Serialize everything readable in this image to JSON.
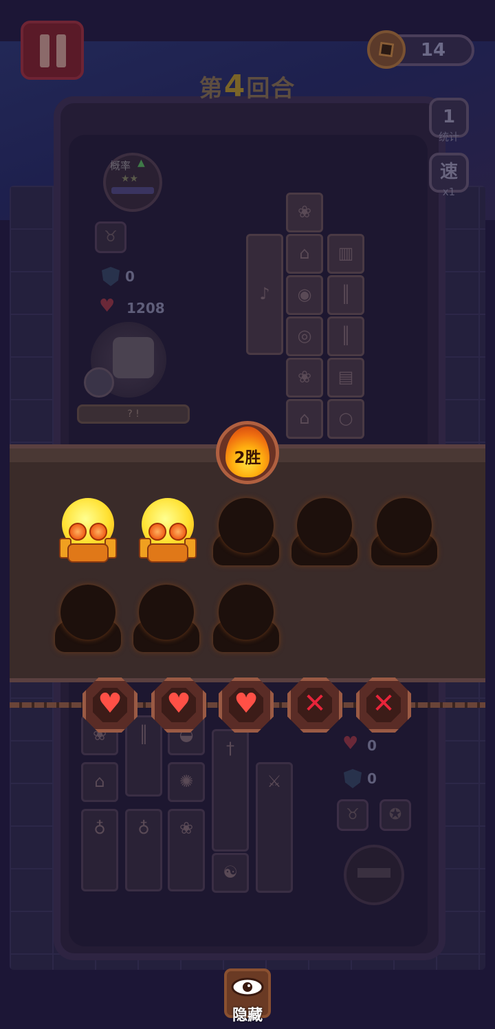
{
  "header": {
    "coin_count": "14",
    "round_prefix": "第",
    "round_number": "4",
    "round_suffix": "回合"
  },
  "side_buttons": [
    {
      "icon": "1",
      "label": "统计"
    },
    {
      "icon": "速",
      "label": "x1"
    }
  ],
  "opponent": {
    "probability_label": "概率",
    "shield": "0",
    "health": "1208",
    "name_plate": "? !"
  },
  "result_panel": {
    "wins_label": "2胜",
    "slots_filled": 2,
    "slots_total": 8
  },
  "lives": [
    {
      "state": "heart"
    },
    {
      "state": "heart"
    },
    {
      "state": "heart"
    },
    {
      "state": "lost"
    },
    {
      "state": "lost"
    }
  ],
  "player": {
    "health": "0",
    "shield": "0"
  },
  "hide_button": {
    "label": "隐藏"
  },
  "colors": {
    "heart": "#ff5046",
    "lost": "#e8243a",
    "flame": "#ffb010",
    "panel": "#3a2b29"
  }
}
